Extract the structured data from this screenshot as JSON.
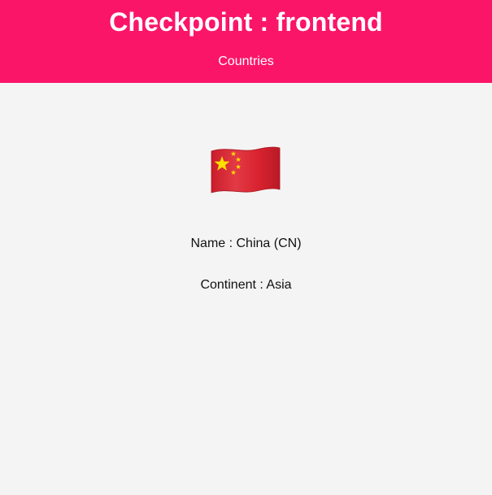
{
  "header": {
    "title": "Checkpoint : frontend",
    "nav_link": "Countries"
  },
  "country": {
    "flag_icon": "china-flag-icon",
    "name_line": "Name : China (CN)",
    "continent_line": "Continent : Asia"
  },
  "colors": {
    "header_bg": "#fb1569",
    "page_bg": "#f4f4f4",
    "flag_red": "#d8222f",
    "flag_star": "#ffde00"
  }
}
